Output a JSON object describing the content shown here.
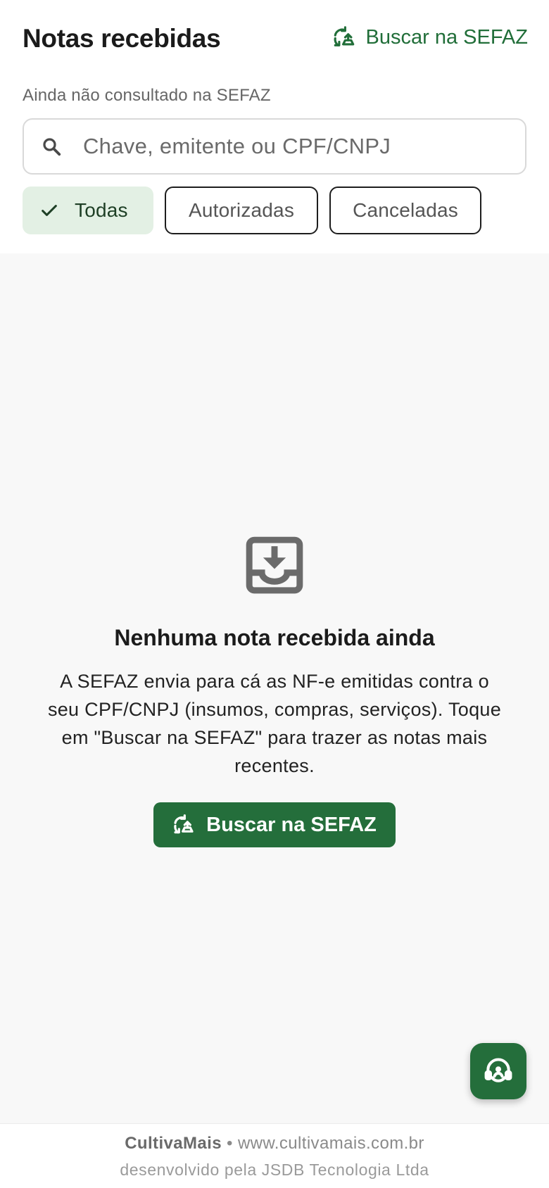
{
  "header": {
    "title": "Notas recebidas",
    "sefaz_link_label": "Buscar na SEFAZ",
    "subtitle": "Ainda não consultado na SEFAZ"
  },
  "search": {
    "placeholder": "Chave, emitente ou CPF/CNPJ",
    "value": ""
  },
  "filters": [
    {
      "label": "Todas",
      "selected": true
    },
    {
      "label": "Autorizadas",
      "selected": false
    },
    {
      "label": "Canceladas",
      "selected": false
    }
  ],
  "empty_state": {
    "icon": "inbox-download-icon",
    "title": "Nenhuma nota recebida ainda",
    "text": "A SEFAZ envia para cá as NF-e emitidas contra o seu CPF/CNPJ (insumos, compras, serviços). Toque em \"Buscar na SEFAZ\" para trazer as notas mais recentes.",
    "button_label": "Buscar na SEFAZ"
  },
  "fab": {
    "icon": "support-agent-icon"
  },
  "footer": {
    "brand": "CultivaMais",
    "separator": "•",
    "website": "www.cultivamais.com.br",
    "developer": "desenvolvido pela JSDB Tecnologia Ltda"
  },
  "colors": {
    "primary": "#246e3b",
    "chip_active_bg": "#e3f0e4",
    "background": "#f8f8f8"
  }
}
